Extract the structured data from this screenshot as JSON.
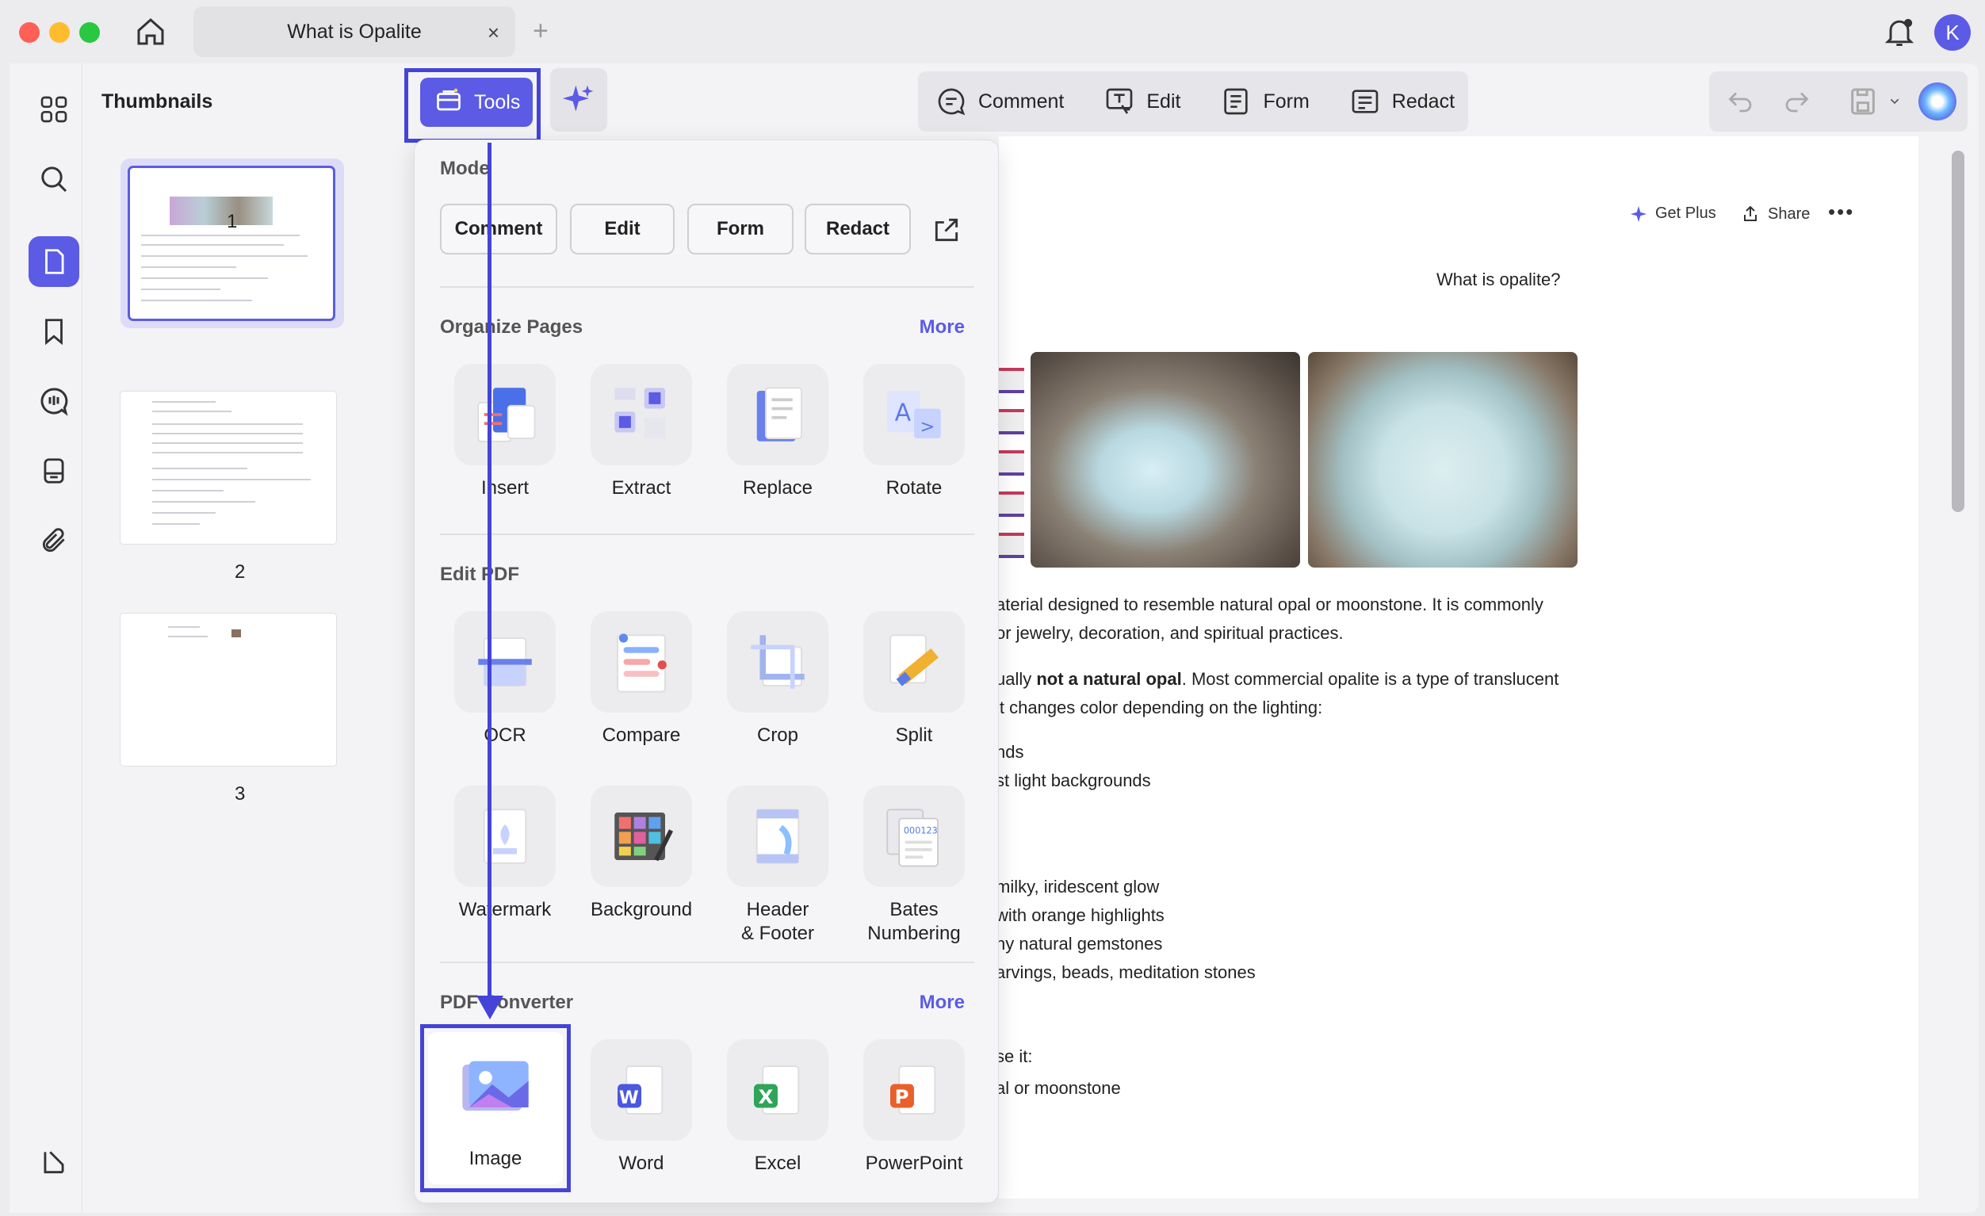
{
  "titlebar": {
    "tab_title": "What is Opalite",
    "tab_close": "×",
    "tab_add": "+",
    "avatar_initial": "K"
  },
  "thumbnails": {
    "title": "Thumbnails",
    "pages": [
      "1",
      "2",
      "3"
    ]
  },
  "toolbar": {
    "tools_label": "Tools",
    "modes": [
      "Comment",
      "Edit",
      "Form",
      "Redact"
    ]
  },
  "panel": {
    "mode_title": "Mode",
    "mode_buttons": [
      "Comment",
      "Edit",
      "Form",
      "Redact"
    ],
    "organize_title": "Organize Pages",
    "organize_more": "More",
    "organize_tools": [
      "Insert",
      "Extract",
      "Replace",
      "Rotate"
    ],
    "edit_title": "Edit PDF",
    "edit_tools_row1": [
      "OCR",
      "Compare",
      "Crop",
      "Split"
    ],
    "edit_tools_row2": [
      "Watermark",
      "Background",
      "Header\n& Footer",
      "Bates\nNumbering"
    ],
    "converter_title": "PDF Converter",
    "converter_more": "More",
    "converter_tools": [
      "Image",
      "Word",
      "Excel",
      "PowerPoint"
    ]
  },
  "document": {
    "get_plus": "Get Plus",
    "share": "Share",
    "more": "•••",
    "question": "What is opalite?",
    "lines": [
      "aterial designed to resemble natural opal or moonstone. It is commonly",
      "or jewelry, decoration, and spiritual practices.",
      "ually not a natural opal. Most commercial opalite is a type of translucent",
      "it changes color depending on the lighting:",
      "nds",
      "st light backgrounds",
      "milky, iridescent glow",
      "with orange highlights",
      "ny natural gemstones",
      "arvings, beads, meditation stones",
      "se it:",
      "al or moonstone"
    ],
    "bold_phrase": "not a natural opal"
  },
  "colors": {
    "accent": "#5b5be6",
    "highlight": "#4444d9"
  }
}
